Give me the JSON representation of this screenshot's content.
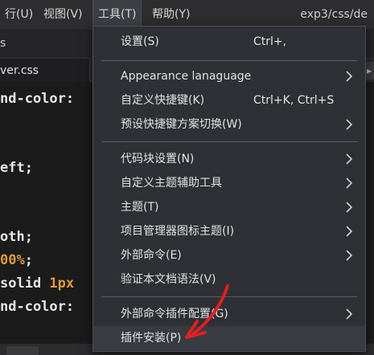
{
  "menubar": {
    "items": [
      {
        "label": "行(U)"
      },
      {
        "label": "视图(V)"
      },
      {
        "label": "工具(T)"
      },
      {
        "label": "帮助(Y)"
      }
    ],
    "title": "exp3/css/de"
  },
  "toolbar": {
    "text": "s"
  },
  "tabs": {
    "active_label": "ver.css"
  },
  "code": {
    "lines": [
      {
        "text": "nd-color:"
      },
      {
        "text": "eft;"
      },
      {
        "text": "oth;"
      },
      {
        "num": "00%",
        "text": ";"
      },
      {
        "text": "solid ",
        "num": "1px"
      },
      {
        "text": "nd-color:"
      }
    ]
  },
  "tools_menu": {
    "items": [
      {
        "label": "设置(S)",
        "shortcut": "Ctrl+,"
      },
      {
        "label": "Appearance lanaguage",
        "icon": "chevron-right-icon"
      },
      {
        "label": "自定义快捷键(K)",
        "shortcut": "Ctrl+K, Ctrl+S"
      },
      {
        "label": "预设快捷键方案切换(W)",
        "icon": "chevron-right-icon"
      },
      {
        "label": "代码块设置(N)",
        "icon": "chevron-right-icon"
      },
      {
        "label": "自定义主题辅助工具",
        "icon": "chevron-right-icon"
      },
      {
        "label": "主题(T)",
        "icon": "chevron-right-icon"
      },
      {
        "label": "项目管理器图标主题(I)",
        "icon": "chevron-right-icon"
      },
      {
        "label": "外部命令(E)",
        "icon": "chevron-right-icon"
      },
      {
        "label": "验证本文档语法(V)"
      },
      {
        "label": "外部命令插件配置(G)",
        "icon": "chevron-right-icon"
      },
      {
        "label": "插件安装(P)"
      }
    ]
  },
  "colors": {
    "menu_bg": "#2e3035",
    "editor_bg": "#1b1b1c",
    "number_orange": "#e09a3a",
    "annotation_red": "#e02020"
  }
}
